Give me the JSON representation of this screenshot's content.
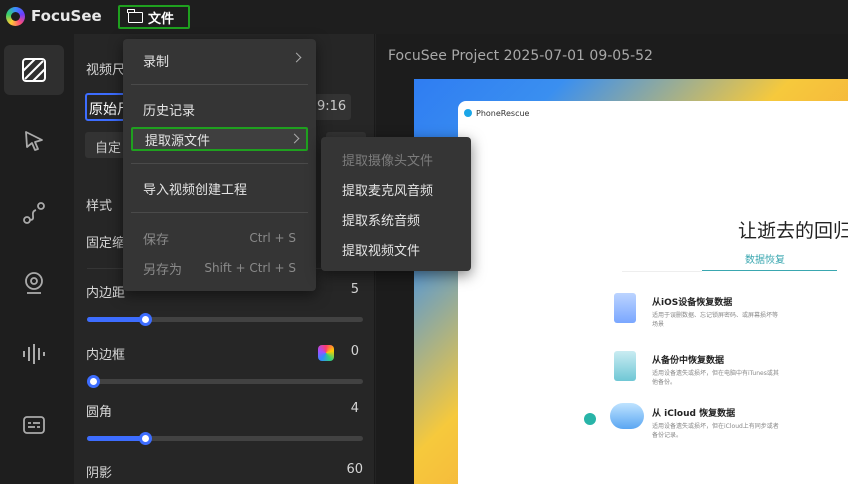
{
  "app": {
    "name": "FocuSee"
  },
  "menubar": {
    "file_label": "文件"
  },
  "panel": {
    "video_label": "视频尺",
    "ratio_value": "原始尺",
    "ratio_916": "9:16",
    "custom_label": "自定",
    "style_label": "样式",
    "fixed_label": "固定缩",
    "padding_label": "内边距",
    "padding_value": "5",
    "padding_pct": 21,
    "border_label": "内边框",
    "border_value": "0",
    "border_pct": 0,
    "radius_label": "圆角",
    "radius_value": "4",
    "radius_pct": 21,
    "shadow_label": "阴影",
    "shadow_value": "60"
  },
  "preview": {
    "project_title": "FocuSee Project 2025-07-01 09-05-52",
    "window_app": "PhoneRescue",
    "heading": "让逝去的回归",
    "tab": "数据恢复",
    "items": [
      {
        "title": "从iOS设备恢复数据",
        "desc": "适用于误删数据、忘记锁屏密码、或屏幕损坏等场景"
      },
      {
        "title": "从备份中恢复数据",
        "desc": "适用设备遗失或损坏，但在电脑中有iTunes或其他备份。"
      },
      {
        "title": "从 iCloud 恢复数据",
        "desc": "适用设备遗失或损坏，但在iCloud上有同步或者备份记录。"
      }
    ]
  },
  "menu": {
    "record": "录制",
    "history": "历史记录",
    "extract": "提取源文件",
    "import": "导入视频创建工程",
    "save": "保存",
    "save_shortcut": "Ctrl + S",
    "save_as": "另存为",
    "save_as_shortcut": "Shift + Ctrl + S"
  },
  "submenu": {
    "camera": "提取摄像头文件",
    "mic": "提取麦克风音频",
    "system": "提取系统音频",
    "video": "提取视频文件"
  },
  "colors": {
    "accent": "#3d6dff",
    "highlight": "#1fa01f"
  }
}
